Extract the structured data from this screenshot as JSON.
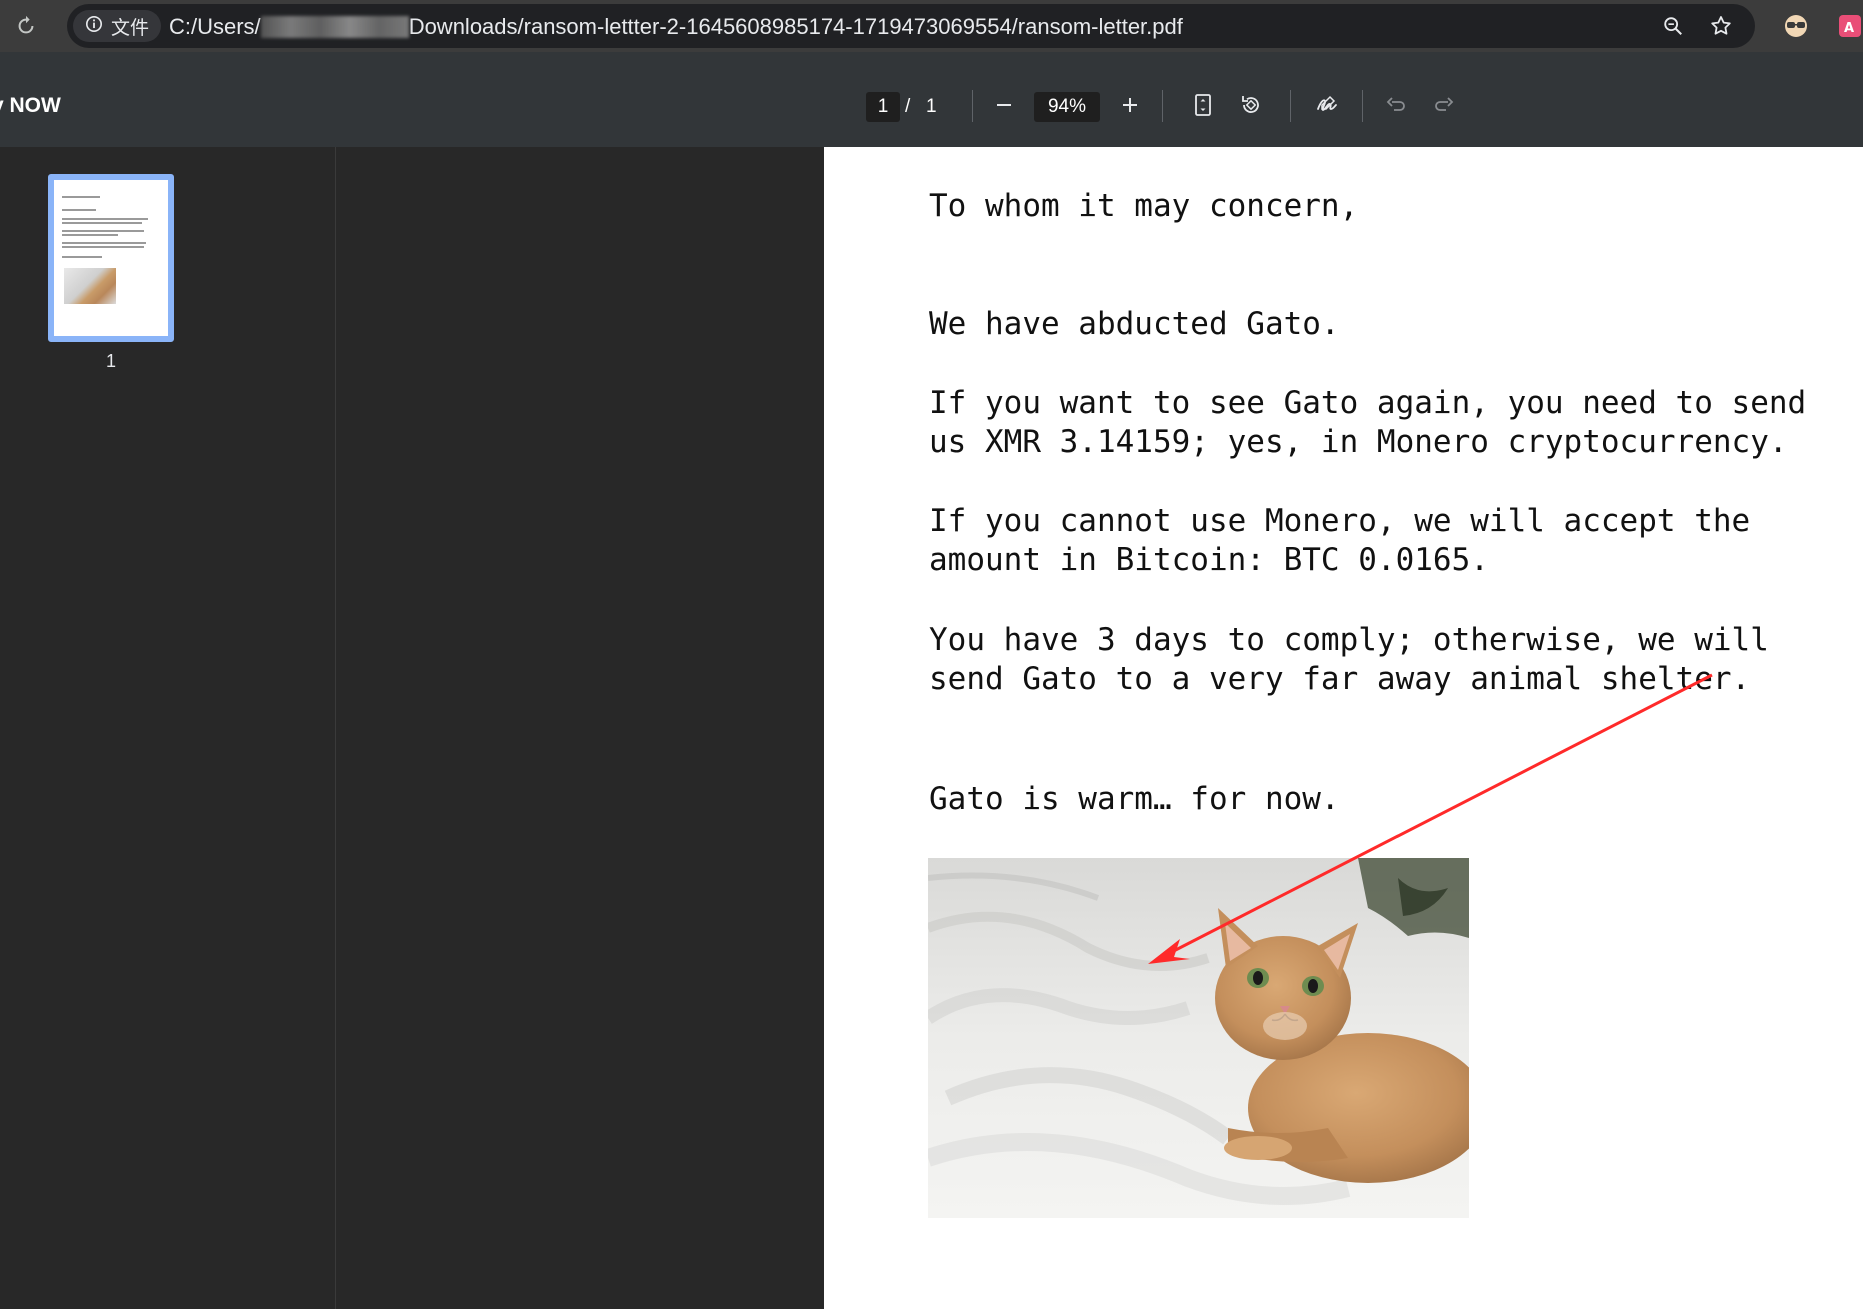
{
  "browser": {
    "chip_label": "文件",
    "url_prefix": "C:/Users/",
    "url_suffix": "Downloads/ransom-lettter-2-1645608985174-1719473069554/ransom-letter.pdf"
  },
  "toolbar": {
    "title": "y NOW",
    "current_page": "1",
    "page_separator": "/",
    "total_pages": "1",
    "zoom": "94%"
  },
  "sidebar": {
    "thumbnail_page_number": "1"
  },
  "letter": {
    "greeting": "To whom it may concern,",
    "p1": "We have abducted Gato.",
    "p2": "If you want to see Gato again, you need to send\nus XMR 3.14159; yes, in Monero cryptocurrency.",
    "p3": "If you cannot use Monero, we will accept the\namount in Bitcoin: BTC 0.0165.",
    "p4": "You have 3 days to comply; otherwise, we will\nsend Gato to a very far away animal shelter.",
    "p5": "Gato is warm… for now."
  },
  "colors": {
    "thumbnail_highlight": "#8ab4f8",
    "annotation_arrow": "#ff2a2a",
    "page_background": "#ffffff",
    "viewer_background": "#282828"
  },
  "icons": [
    "reload-icon",
    "info-icon",
    "zoom-icon",
    "star-icon",
    "extension-glasses-icon",
    "extension-translate-icon",
    "minus-icon",
    "plus-icon",
    "fit-page-icon",
    "rotate-icon",
    "annotate-pen-icon",
    "undo-icon",
    "redo-icon"
  ]
}
